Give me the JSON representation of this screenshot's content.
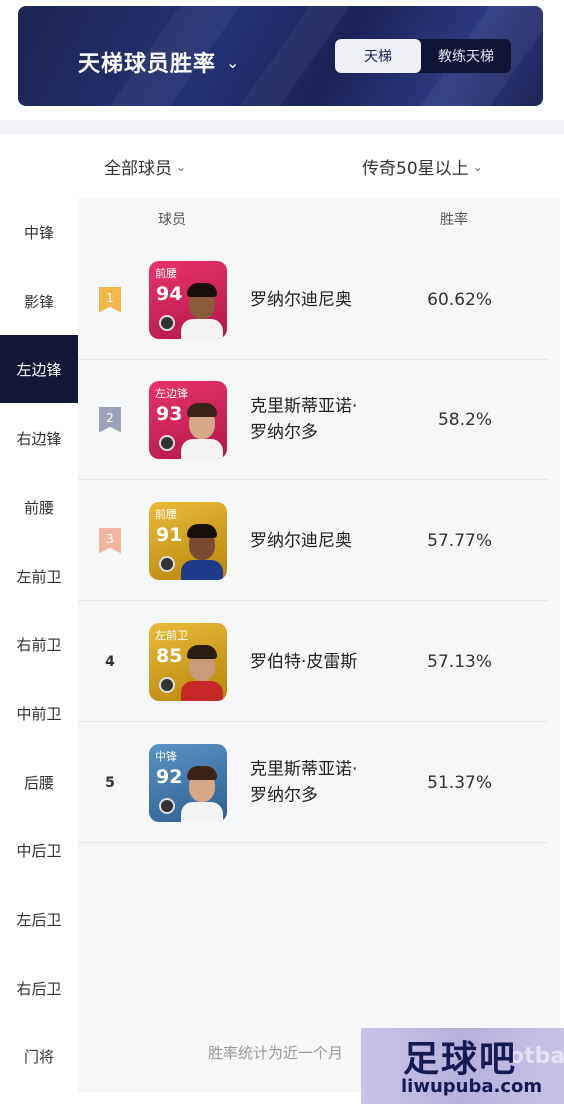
{
  "header": {
    "title": "天梯球员胜率",
    "toggle": {
      "active": "天梯",
      "inactive": "教练天梯"
    }
  },
  "filters": {
    "left": "全部球员",
    "right": "传奇50星以上"
  },
  "sidebar": {
    "items": [
      "中锋",
      "影锋",
      "左边锋",
      "右边锋",
      "前腰",
      "左前卫",
      "右前卫",
      "中前卫",
      "后腰",
      "中后卫",
      "左后卫",
      "右后卫",
      "门将"
    ],
    "active_index": 2
  },
  "table": {
    "headers": {
      "player": "球员",
      "winrate": "胜率"
    },
    "rows": [
      {
        "rank": "1",
        "position": "前腰",
        "rating": "94",
        "name_line1": "罗纳尔迪尼奥",
        "name_line2": "",
        "winrate": "60.62%",
        "card_color": "#d8235b",
        "rank_color": "#f2b84b"
      },
      {
        "rank": "2",
        "position": "左边锋",
        "rating": "93",
        "name_line1": "克里斯蒂亚诺·",
        "name_line2": "罗纳尔多",
        "winrate": "58.2%",
        "card_color": "#d8235b",
        "rank_color": "#9aa3b8"
      },
      {
        "rank": "3",
        "position": "前腰",
        "rating": "91",
        "name_line1": "罗纳尔迪尼奥",
        "name_line2": "",
        "winrate": "57.77%",
        "card_color": "#d4a020",
        "rank_color": "#f0b7a0"
      },
      {
        "rank": "4",
        "position": "左前卫",
        "rating": "85",
        "name_line1": "罗伯特·皮雷斯",
        "name_line2": "",
        "winrate": "57.13%",
        "card_color": "#d4a020",
        "rank_color": ""
      },
      {
        "rank": "5",
        "position": "中锋",
        "rating": "92",
        "name_line1": "克里斯蒂亚诺·",
        "name_line2": "罗纳尔多",
        "winrate": "51.37%",
        "card_color": "#4a7fb0",
        "rank_color": ""
      }
    ]
  },
  "footnote": "胜率统计为近一个月",
  "watermark": {
    "logo": "足球吧",
    "url": "liwupuba.com",
    "ghost": "otba"
  }
}
